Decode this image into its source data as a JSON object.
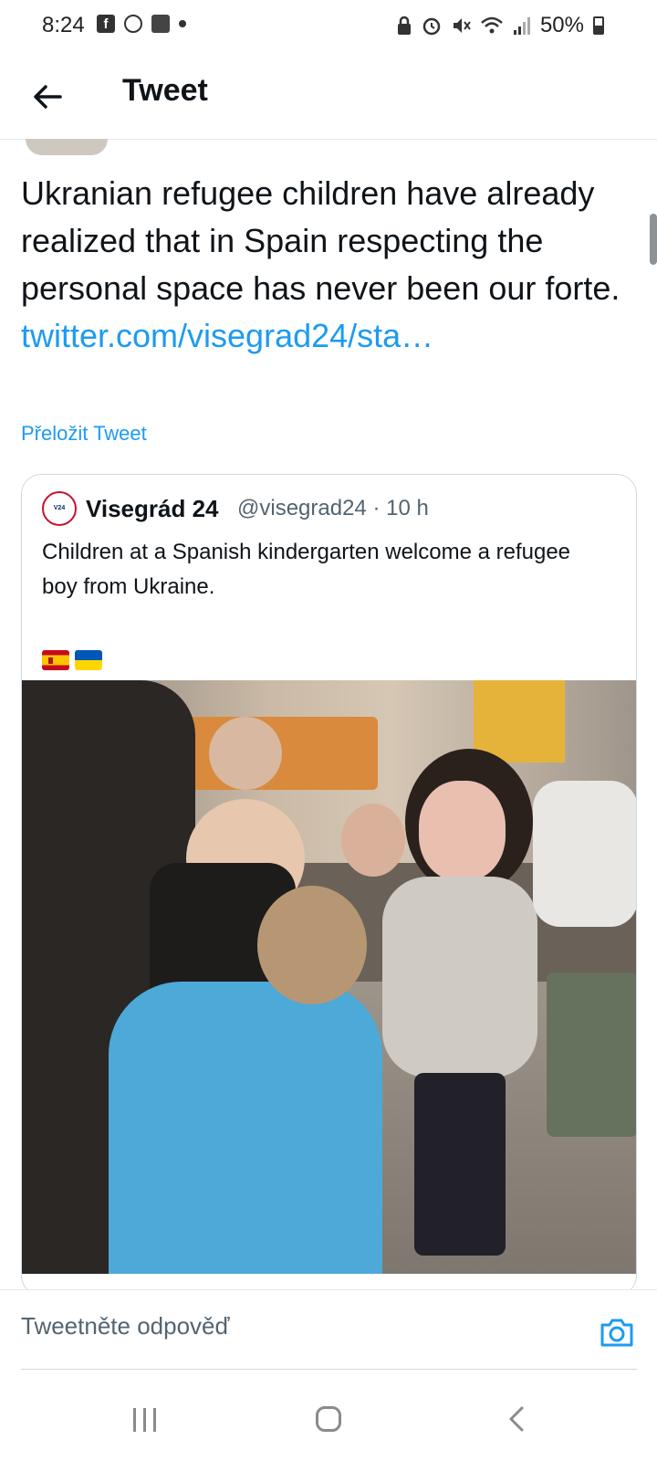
{
  "status_bar": {
    "time": "8:24",
    "battery": "50%",
    "left_icons": [
      "facebook-icon",
      "whatsapp-icon",
      "gallery-icon",
      "dot-icon"
    ],
    "right_icons": [
      "lock-icon",
      "alarm-icon",
      "mute-icon",
      "wifi-icon",
      "signal-icon",
      "battery-icon"
    ]
  },
  "header": {
    "title": "Tweet"
  },
  "tweet": {
    "text": "Ukranian refugee children have already realized that in Spain respecting the personal space has never been our forte.",
    "link": "twitter.com/visegrad24/sta…",
    "translate": "Přeložit Tweet"
  },
  "quoted_tweet": {
    "name": "Visegrád 24",
    "meta": "@visegrad24 · 10 h",
    "text": "Children at a Spanish kindergarten welcome a refugee boy from Ukraine.",
    "flags": [
      "spain-flag",
      "ukraine-flag"
    ],
    "media": "video-thumbnail-kindergarten"
  },
  "reply": {
    "placeholder": "Tweetněte odpověď"
  },
  "colors": {
    "link": "#1d9bf0",
    "text": "#0f1419",
    "secondary": "#536471",
    "border": "#cfd9de"
  }
}
